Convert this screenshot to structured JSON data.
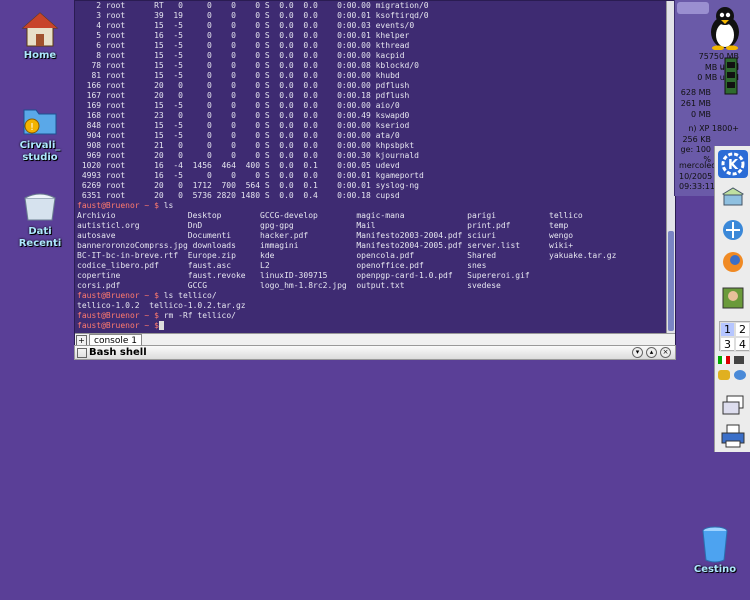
{
  "desktop_icons": {
    "home": "Home",
    "cirvali": "Cirvali_\nstudio",
    "dati": "Dati\nRecenti",
    "trash": "Cestino"
  },
  "terminal": {
    "lines": [
      "    2 root      RT   0     0    0    0 S  0.0  0.0    0:00.00 migration/0",
      "    3 root      39  19     0    0    0 S  0.0  0.0    0:00.01 ksoftirqd/0",
      "    4 root      15  -5     0    0    0 S  0.0  0.0    0:00.03 events/0",
      "    5 root      16  -5     0    0    0 S  0.0  0.0    0:00.01 khelper",
      "    6 root      15  -5     0    0    0 S  0.0  0.0    0:00.00 kthread",
      "    8 root      15  -5     0    0    0 S  0.0  0.0    0:00.00 kacpid",
      "   78 root      15  -5     0    0    0 S  0.0  0.0    0:00.08 kblockd/0",
      "   81 root      15  -5     0    0    0 S  0.0  0.0    0:00.00 khubd",
      "  166 root      20   0     0    0    0 S  0.0  0.0    0:00.00 pdflush",
      "  167 root      20   0     0    0    0 S  0.0  0.0    0:00.18 pdflush",
      "  169 root      15  -5     0    0    0 S  0.0  0.0    0:00.00 aio/0",
      "  168 root      23   0     0    0    0 S  0.0  0.0    0:00.49 kswapd0",
      "  848 root      15  -5     0    0    0 S  0.0  0.0    0:00.00 kseriod",
      "  904 root      15  -5     0    0    0 S  0.0  0.0    0:00.00 ata/0",
      "  908 root      21   0     0    0    0 S  0.0  0.0    0:00.00 khpsbpkt",
      "  969 root      20   0     0    0    0 S  0.0  0.0    0:00.30 kjournald",
      " 1020 root      16  -4  1456  464  400 S  0.0  0.1    0:00.05 udevd",
      " 4993 root      16  -5     0    0    0 S  0.0  0.0    0:00.01 kgameportd",
      " 6269 root      20   0  1712  700  564 S  0.0  0.1    0:00.01 syslog-ng",
      " 6351 root      20   0  5736 2820 1480 S  0.0  0.4    0:00.18 cupsd"
    ],
    "prompt": "faust@Bruenor ~ $",
    "cmd_ls": " ls",
    "ls_output": [
      "Archivio               Desktop        GCCG-develop        magic-mana             parigi           tellico",
      "autisticl.org          DnD            gpg-gpg             Mail                   print.pdf        temp",
      "autosave               Documenti      hacker.pdf          Manifesto2003-2004.pdf sciuri           wengo",
      "banneroronzoComprss.jpg downloads     immagini            Manifesto2004-2005.pdf server.list      wiki+",
      "BC-IT-bc-in-breve.rtf  Europe.zip     kde                 opencola.pdf           Shared           yakuake.tar.gz",
      "codice_libero.pdf      faust.asc      L2                  openoffice.pdf         snes",
      "copertine              faust.revoke   linuxID-309715      openpgp-card-1.0.pdf   Supereroi.gif",
      "corsi.pdf              GCCG           logo_hm-1.8rc2.jpg  output.txt             svedese"
    ],
    "cmd_ls_tellico": " ls tellico/",
    "tellico_output": "tellico-1.0.2  tellico-1.0.2.tar.gz",
    "cmd_rm": " rm -Rf tellico/",
    "tab_label": "console 1",
    "window_title": "Bash shell"
  },
  "sysmon": {
    "lines": [
      "75750 MB used",
      "MB used",
      "0 MB used",
      "628 MB",
      "261 MB",
      "0 MB",
      "n) XP 1800+",
      "256 KB",
      "ge:  100 %",
      "mercoledì",
      "10/2005",
      "09:33:11"
    ]
  },
  "pager": [
    "1",
    "2",
    "3",
    "4"
  ]
}
